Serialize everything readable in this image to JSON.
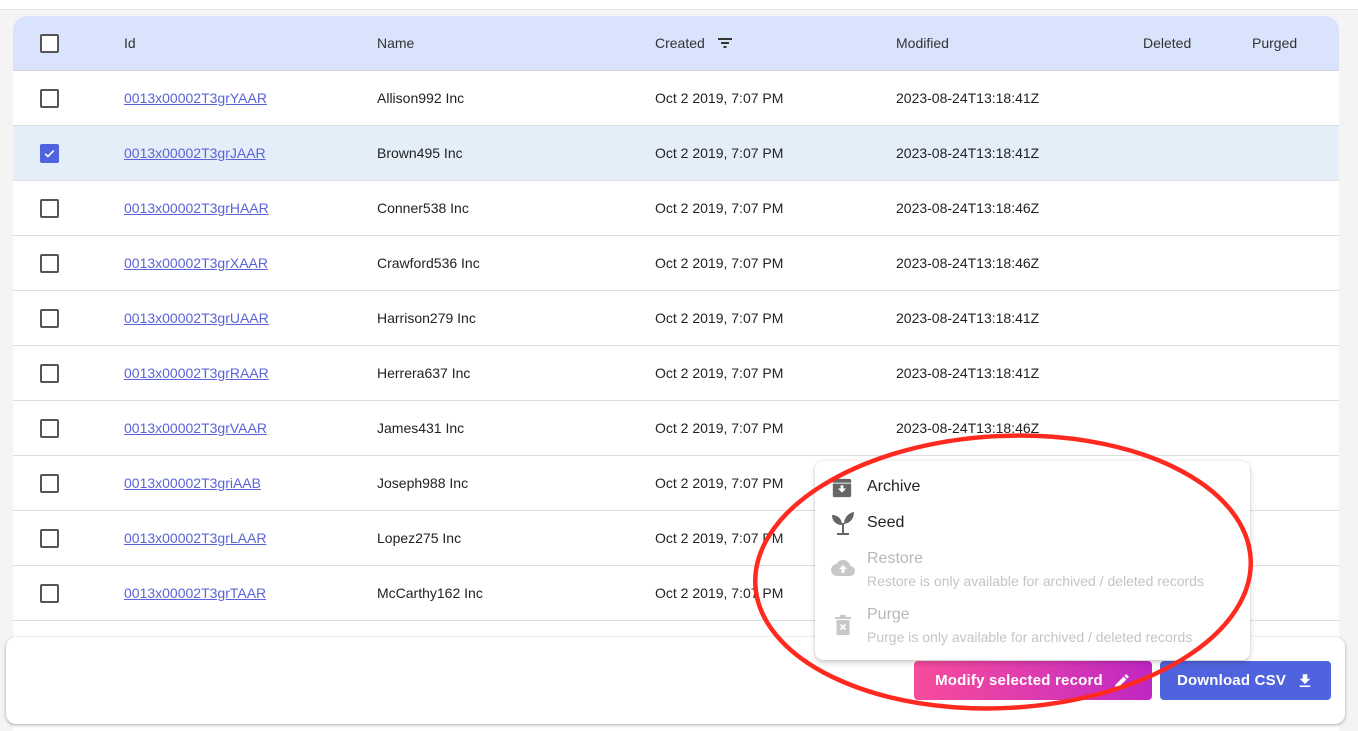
{
  "table": {
    "headers": {
      "id": "Id",
      "name": "Name",
      "created": "Created",
      "modified": "Modified",
      "deleted": "Deleted",
      "purged": "Purged"
    },
    "select_all_checked": false,
    "sort_icon": "filter-list-icon",
    "rows": [
      {
        "id": "0013x00002T3grYAAR",
        "name": "Allison992 Inc",
        "created": "Oct 2 2019, 7:07 PM",
        "modified": "2023-08-24T13:18:41Z",
        "deleted": "",
        "purged": "",
        "selected": false
      },
      {
        "id": "0013x00002T3grJAAR",
        "name": "Brown495 Inc",
        "created": "Oct 2 2019, 7:07 PM",
        "modified": "2023-08-24T13:18:41Z",
        "deleted": "",
        "purged": "",
        "selected": true
      },
      {
        "id": "0013x00002T3grHAAR",
        "name": "Conner538 Inc",
        "created": "Oct 2 2019, 7:07 PM",
        "modified": "2023-08-24T13:18:46Z",
        "deleted": "",
        "purged": "",
        "selected": false
      },
      {
        "id": "0013x00002T3grXAAR",
        "name": "Crawford536 Inc",
        "created": "Oct 2 2019, 7:07 PM",
        "modified": "2023-08-24T13:18:46Z",
        "deleted": "",
        "purged": "",
        "selected": false
      },
      {
        "id": "0013x00002T3grUAAR",
        "name": "Harrison279 Inc",
        "created": "Oct 2 2019, 7:07 PM",
        "modified": "2023-08-24T13:18:41Z",
        "deleted": "",
        "purged": "",
        "selected": false
      },
      {
        "id": "0013x00002T3grRAAR",
        "name": "Herrera637 Inc",
        "created": "Oct 2 2019, 7:07 PM",
        "modified": "2023-08-24T13:18:41Z",
        "deleted": "",
        "purged": "",
        "selected": false
      },
      {
        "id": "0013x00002T3grVAAR",
        "name": "James431 Inc",
        "created": "Oct 2 2019, 7:07 PM",
        "modified": "2023-08-24T13:18:46Z",
        "deleted": "",
        "purged": "",
        "selected": false
      },
      {
        "id": "0013x00002T3griAAB",
        "name": "Joseph988 Inc",
        "created": "Oct 2 2019, 7:07 PM",
        "modified": "",
        "deleted": "",
        "purged": "",
        "selected": false
      },
      {
        "id": "0013x00002T3grLAAR",
        "name": "Lopez275 Inc",
        "created": "Oct 2 2019, 7:07 PM",
        "modified": "",
        "deleted": "",
        "purged": "",
        "selected": false
      },
      {
        "id": "0013x00002T3grTAAR",
        "name": "McCarthy162 Inc",
        "created": "Oct 2 2019, 7:07 PM",
        "modified": "",
        "deleted": "",
        "purged": "",
        "selected": false
      }
    ]
  },
  "menu": {
    "items": [
      {
        "label": "Archive",
        "icon": "archive-icon",
        "disabled": false,
        "description": ""
      },
      {
        "label": "Seed",
        "icon": "seedling-icon",
        "disabled": false,
        "description": ""
      },
      {
        "label": "Restore",
        "icon": "cloud-upload-icon",
        "disabled": true,
        "description": "Restore is only available for archived / deleted records"
      },
      {
        "label": "Purge",
        "icon": "delete-forever-icon",
        "disabled": true,
        "description": "Purge is only available for archived / deleted records"
      }
    ]
  },
  "actions": {
    "modify_label": "Modify selected record",
    "modify_icon": "pencil-icon",
    "download_label": "Download CSV",
    "download_icon": "download-icon"
  },
  "colors": {
    "accent": "#5063de",
    "header_bg": "#d9e3fc",
    "selected_row_bg": "#e4eef9",
    "link": "#5a63d8",
    "modify_gradient_start": "#f74c9b",
    "modify_gradient_end": "#bf26c3",
    "annotation_circle": "#ff2a1f"
  }
}
